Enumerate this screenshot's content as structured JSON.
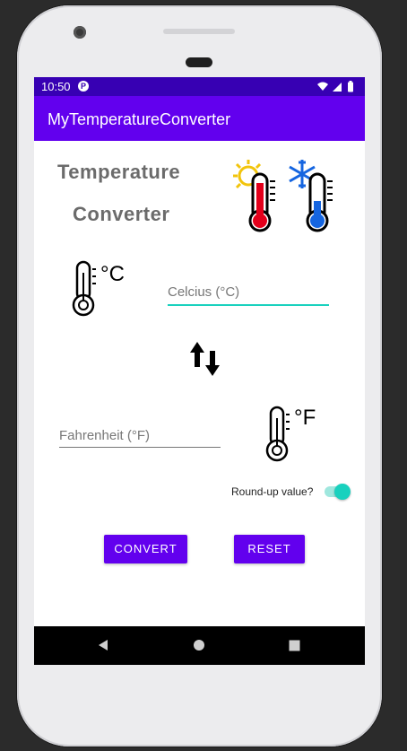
{
  "status_bar": {
    "time": "10:50",
    "notification_icon": "p-icon"
  },
  "app_bar": {
    "title": "MyTemperatureConverter"
  },
  "header": {
    "title_line1": "Temperature",
    "title_line2": "Converter"
  },
  "celsius_field": {
    "placeholder": "Celcius (°C)",
    "value": ""
  },
  "fahrenheit_field": {
    "placeholder": "Fahrenheit (°F)",
    "value": ""
  },
  "round_switch": {
    "label": "Round-up value?",
    "checked": true
  },
  "buttons": {
    "convert": "CONVERT",
    "reset": "RESET"
  },
  "icons": {
    "celsius_unit": "°C",
    "fahrenheit_unit": "°F"
  },
  "colors": {
    "primary": "#6200ee",
    "primary_dark": "#3700b3",
    "accent": "#19d1be",
    "hot": "#e3001b",
    "cold": "#1565e0"
  }
}
